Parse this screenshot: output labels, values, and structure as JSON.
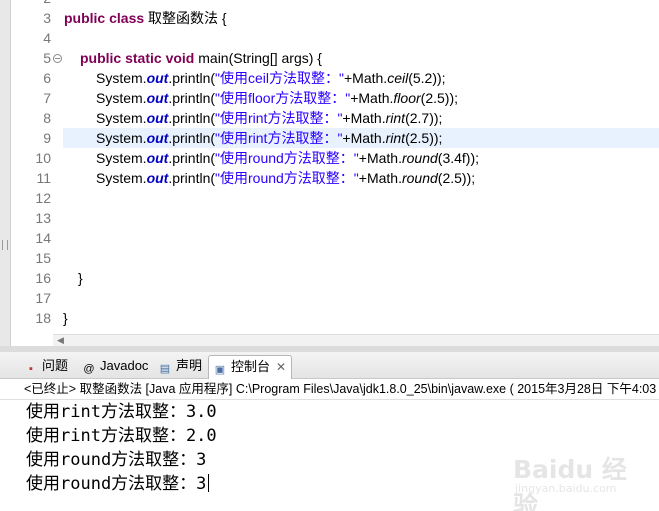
{
  "editor": {
    "line_numbers": [
      "2",
      "3",
      "4",
      "5",
      "6",
      "7",
      "8",
      "9",
      "10",
      "11",
      "12",
      "13",
      "14",
      "15",
      "16",
      "17",
      "18"
    ],
    "line3": {
      "kw": "public class",
      "name": " 取整函数法 {"
    },
    "line5": {
      "kw": "public static void",
      "rest": " main(String[] args) {"
    },
    "println_lines": [
      {
        "obj": "System.",
        "fld": "out",
        "method": ".println(",
        "str": "\"使用ceil方法取整：\"",
        "concat": "+Math.",
        "fn": "ceil",
        "args": "(5.2));"
      },
      {
        "obj": "System.",
        "fld": "out",
        "method": ".println(",
        "str": "\"使用floor方法取整：\"",
        "concat": "+Math.",
        "fn": "floor",
        "args": "(2.5));"
      },
      {
        "obj": "System.",
        "fld": "out",
        "method": ".println(",
        "str": "\"使用rint方法取整：\"",
        "concat": "+Math.",
        "fn": "rint",
        "args": "(2.7));"
      },
      {
        "obj": "System.",
        "fld": "out",
        "method": ".println(",
        "str": "\"使用rint方法取整：\"",
        "concat": "+Math.",
        "fn": "rint",
        "args": "(2.5));"
      },
      {
        "obj": "System.",
        "fld": "out",
        "method": ".println(",
        "str": "\"使用round方法取整：\"",
        "concat": "+Math.",
        "fn": "round",
        "args": "(3.4f));"
      },
      {
        "obj": "System.",
        "fld": "out",
        "method": ".println(",
        "str": "\"使用round方法取整：\"",
        "concat": "+Math.",
        "fn": "round",
        "args": "(2.5));"
      }
    ],
    "close_method": "}",
    "close_class": "}",
    "fold_marker": "−"
  },
  "panel": {
    "tabs": [
      {
        "label": "问题",
        "icon": "problems-icon"
      },
      {
        "label": "Javadoc",
        "icon": "javadoc-icon"
      },
      {
        "label": "声明",
        "icon": "declaration-icon"
      },
      {
        "label": "控制台",
        "icon": "console-icon",
        "active": true
      }
    ],
    "close_symbol": "✕",
    "status": "<已终止> 取整函数法 [Java 应用程序] C:\\Program Files\\Java\\jdk1.8.0_25\\bin\\javaw.exe ( 2015年3月28日 下午4:03",
    "console_lines": [
      "使用rint方法取整：3.0",
      "使用rint方法取整：2.0",
      "使用round方法取整：3",
      "使用round方法取整：3"
    ]
  },
  "watermark": {
    "text": "Baidu 经验",
    "sub": "jingyan.baidu.com"
  },
  "colors": {
    "keyword": "#7f0055",
    "field": "#0000c0",
    "string": "#2a00ff",
    "line_number": "#787878",
    "current_line": "#e8f2fe"
  }
}
